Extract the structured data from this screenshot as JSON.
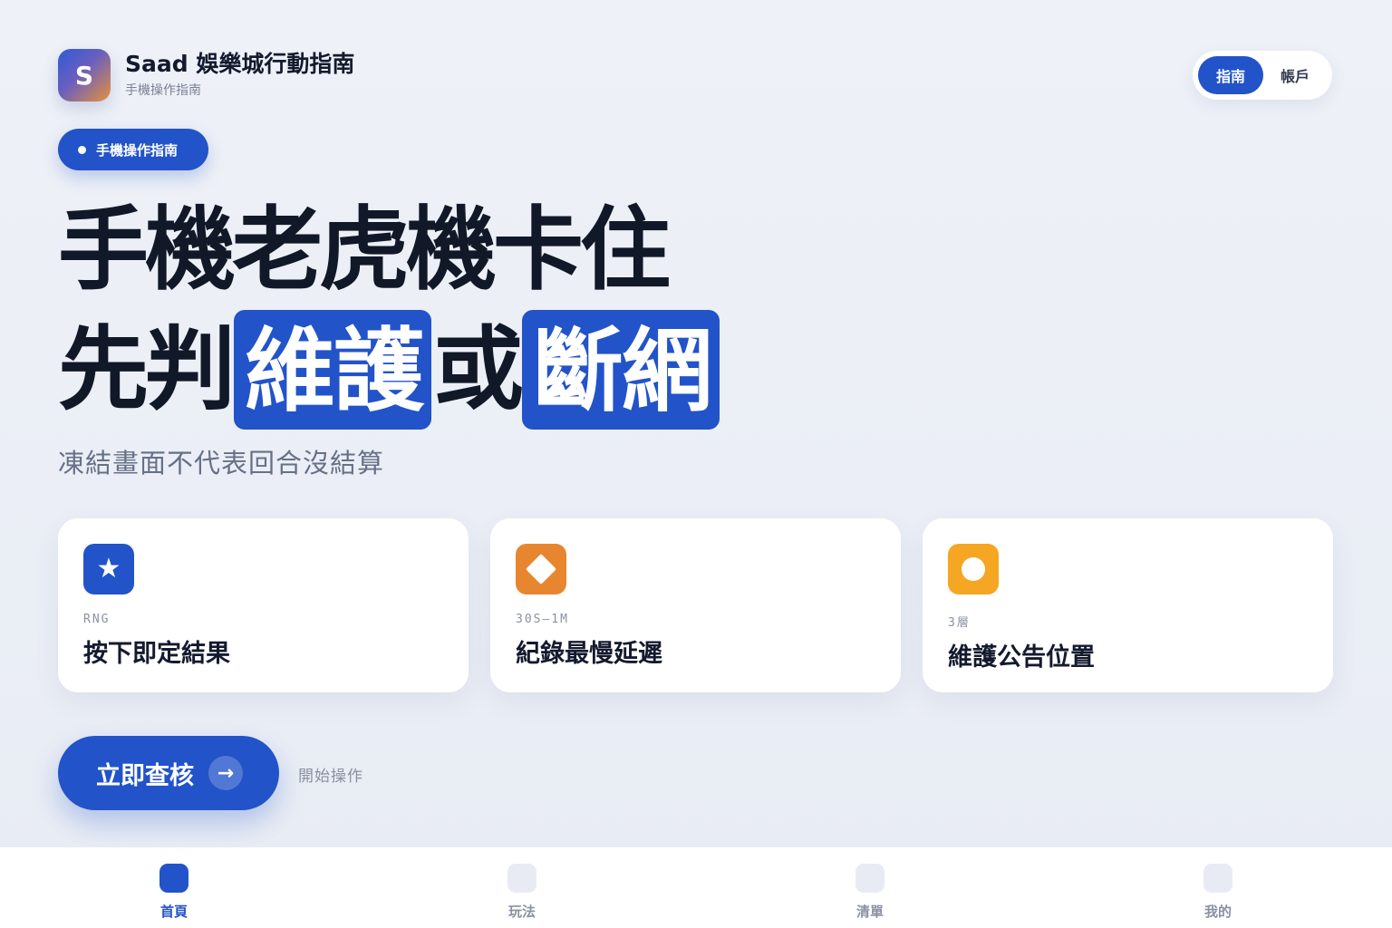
{
  "header": {
    "logo_letter": "S",
    "title": "Saad 娛樂城行動指南",
    "subtitle": "手機操作指南",
    "toggle": {
      "active_label": "指南",
      "inactive_label": "帳戶"
    }
  },
  "hero": {
    "badge": "手機操作指南",
    "line1": "手機老虎機卡住",
    "line2_prefix": "先判",
    "line2_highlight1": "維護",
    "line2_middle": "或",
    "line2_highlight2": "斷網",
    "subtitle": "凍結畫面不代表回合沒結算"
  },
  "cards": [
    {
      "icon": "star-icon",
      "color": "#2253c9",
      "tag": "RNG",
      "title": "按下即定結果"
    },
    {
      "icon": "diamond-icon",
      "color": "#e8862f",
      "tag": "30S–1M",
      "title": "紀錄最慢延遲"
    },
    {
      "icon": "circle-icon",
      "color": "#f5a623",
      "tag": "3層",
      "title": "維護公告位置"
    }
  ],
  "cta": {
    "label": "立即查核",
    "arrow": "→",
    "hint": "開始操作"
  },
  "bottom_nav": [
    {
      "label": "首頁",
      "active": true
    },
    {
      "label": "玩法",
      "active": false
    },
    {
      "label": "清單",
      "active": false
    },
    {
      "label": "我的",
      "active": false
    }
  ],
  "colors": {
    "primary": "#2253c9",
    "orange": "#e8862f",
    "amber": "#f5a623",
    "text": "#141a2e"
  }
}
